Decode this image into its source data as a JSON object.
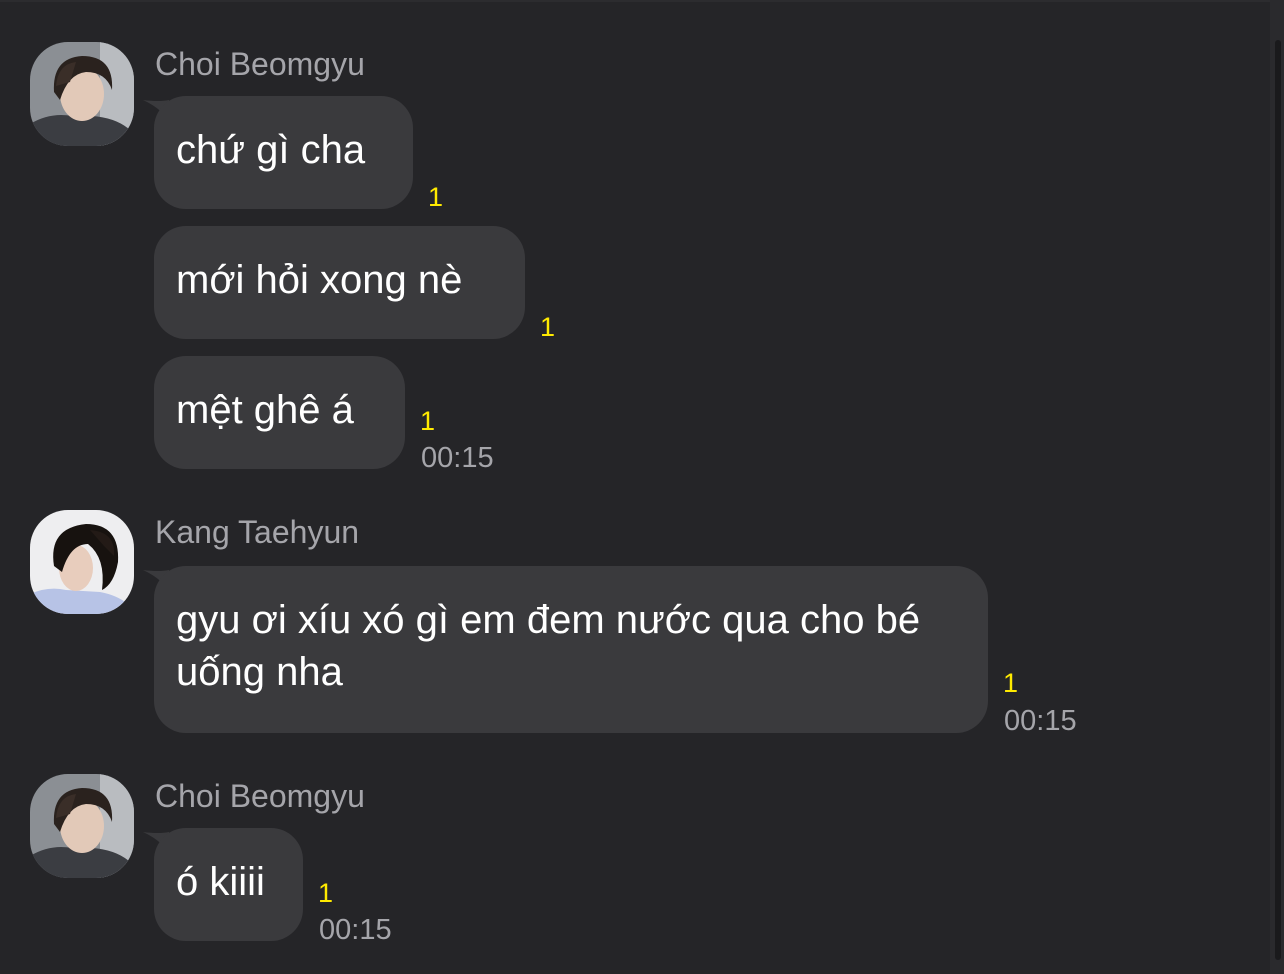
{
  "messages": [
    {
      "sender": "Choi Beomgyu",
      "bubbles": [
        {
          "text": "chứ gì cha",
          "unread": "1"
        },
        {
          "text": "mới hỏi xong nè",
          "unread": "1"
        },
        {
          "text": "mệt ghê á",
          "unread": "1",
          "time": "00:15"
        }
      ]
    },
    {
      "sender": "Kang Taehyun",
      "bubbles": [
        {
          "text": "gyu ơi xíu xó gì em đem nước qua cho bé uống nha",
          "unread": "1",
          "time": "00:15"
        }
      ]
    },
    {
      "sender": "Choi Beomgyu",
      "bubbles": [
        {
          "text": "ó kiiii",
          "unread": "1",
          "time": "00:15"
        }
      ]
    }
  ],
  "colors": {
    "background": "#252528",
    "bubble": "#3a3a3d",
    "message_text": "#ffffff",
    "name_text": "#a5a5aa",
    "unread_count": "#ffea00"
  },
  "icons": {
    "beomgyu_avatar": "profile-photo",
    "taehyun_avatar": "profile-photo"
  }
}
